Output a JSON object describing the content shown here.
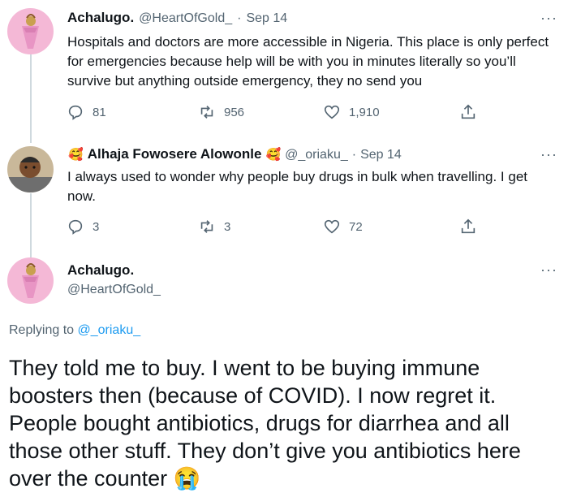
{
  "tweet1": {
    "display_name": "Achalugo.",
    "handle": "@HeartOfGold_",
    "separator": "·",
    "date": "Sep 14",
    "text": "Hospitals and doctors are more accessible in Nigeria. This place is only perfect for emergencies because help will be with you in minutes literally so you’ll survive but anything outside emergency, they no send you",
    "replies": "81",
    "retweets": "956",
    "likes": "1,910"
  },
  "tweet2": {
    "display_name": "Alhaja Fowosere Alowonle",
    "name_emoji": "🥰",
    "handle": "@_oriaku_",
    "separator": "·",
    "date": "Sep 14",
    "text": "I always used to wonder why people buy drugs in bulk when travelling. I get now.",
    "replies": "3",
    "retweets": "3",
    "likes": "72"
  },
  "tweet3": {
    "display_name": "Achalugo.",
    "handle": "@HeartOfGold_",
    "replying_prefix": "Replying to",
    "replying_handle": "@_oriaku_",
    "text": "They told me to buy. I went to be buying immune boosters then (because of COVID). I now regret it. People bought antibiotics, drugs for diarrhea and all those other stuff. They don’t give you antibiotics here over the counter",
    "text_emoji": "😭"
  },
  "more_icon": "···",
  "icons": [
    "reply-icon",
    "retweet-icon",
    "like-icon",
    "share-icon",
    "more-icon"
  ],
  "colors": {
    "link": "#1d9bf0",
    "secondary": "#536471",
    "thread_line": "#cfd9de"
  }
}
